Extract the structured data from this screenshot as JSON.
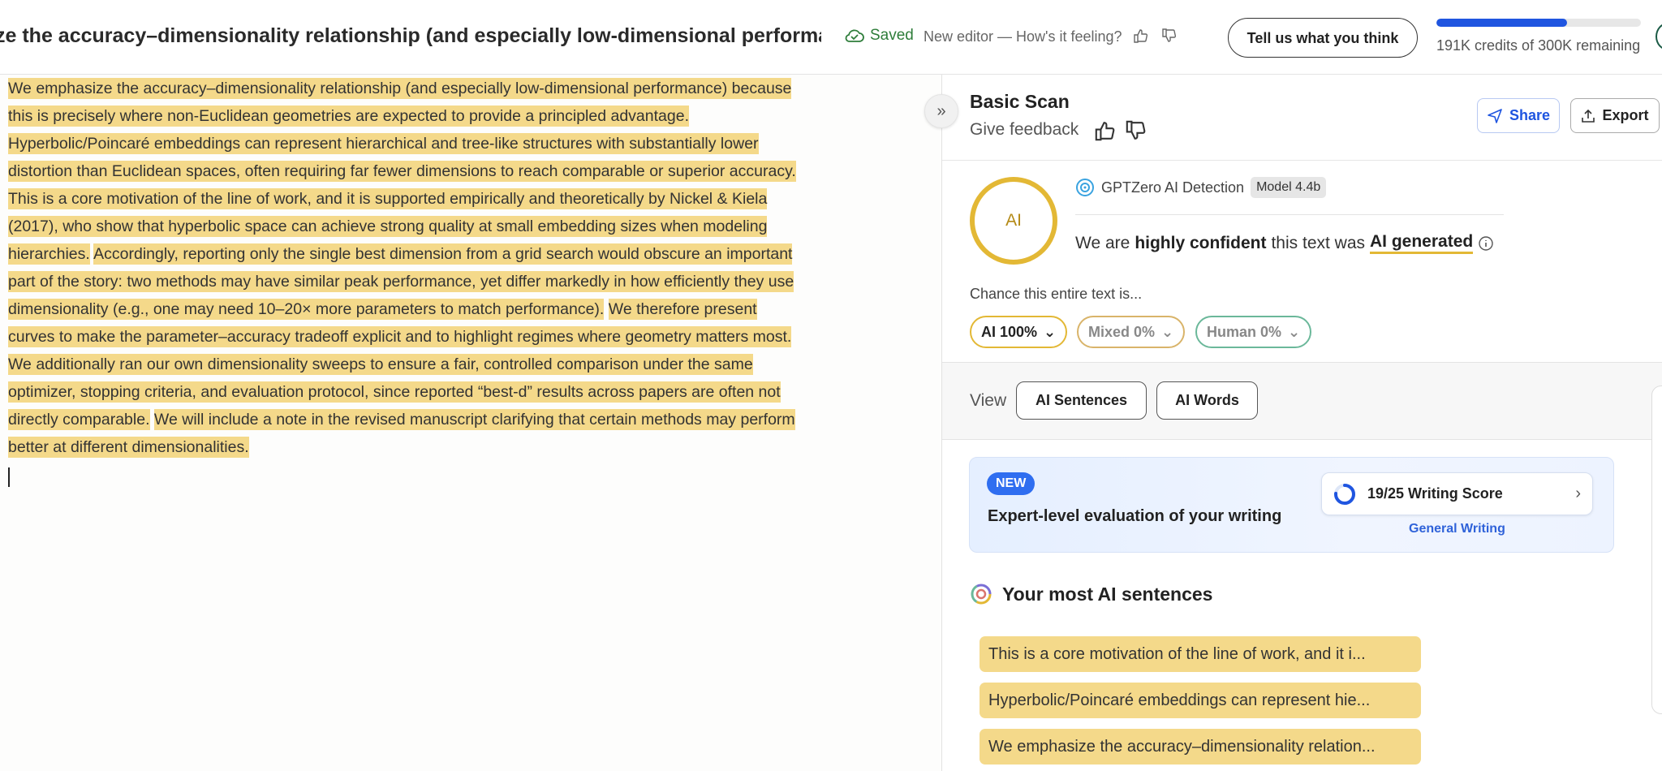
{
  "header": {
    "doc_title": "ze the accuracy–dimensionality relationship (and especially low-dimensional performance) b",
    "saved_label": "Saved",
    "editor_message": "New editor — How's it feeling?",
    "feedback_button": "Tell us what you think",
    "credits_text": "191K credits of 300K remaining",
    "credits_fraction": 0.638
  },
  "editor": {
    "paragraphs": [
      [
        "We emphasize the accuracy–dimensionality relationship (and especially low-dimensional performance) because this is precisely where non-Euclidean geometries are expected to provide a principled advantage.",
        "Hyperbolic/Poincaré embeddings can represent hierarchical and tree-like structures with substantially lower distortion than Euclidean spaces, often requiring far fewer dimensions to reach comparable or superior accuracy.",
        "This is a core motivation of the line of work, and it is supported empirically and theoretically by Nickel & Kiela (2017), who show that hyperbolic space can achieve strong quality at small embedding sizes when modeling hierarchies.",
        "Accordingly, reporting only the single best dimension from a grid search would obscure an important part of the story: two methods may have similar peak performance, yet differ markedly in how efficiently they use dimensionality (e.g., one may need 10–20× more parameters to match performance).",
        "We therefore present curves to make the parameter–accuracy tradeoff explicit and to highlight regimes where geometry matters most."
      ],
      [
        "We additionally ran our own dimensionality sweeps to ensure a fair, controlled comparison under the same optimizer, stopping criteria, and evaluation protocol, since reported “best-d” results across papers are often not directly comparable.",
        "We will include a note in the revised manuscript clarifying that certain methods may perform better at different dimensionalities."
      ]
    ]
  },
  "panel": {
    "title": "Basic Scan",
    "give_feedback": "Give feedback",
    "share_label": "Share",
    "export_label": "Export",
    "ai_badge": "AI",
    "detector_name": "GPTZero AI Detection",
    "model_tag": "Model 4.4b",
    "verdict_pre": "We are",
    "verdict_strong": "highly confident",
    "verdict_mid": "this text was",
    "verdict_ai": "AI generated",
    "chance_label": "Chance this entire text is...",
    "pills": {
      "ai": "AI 100%",
      "mixed": "Mixed 0%",
      "human": "Human 0%"
    },
    "view_label": "View",
    "view_buttons": {
      "sentences": "AI Sentences",
      "words": "AI Words"
    },
    "promo": {
      "badge": "NEW",
      "title": "Expert-level evaluation of your writing",
      "score": "19/25 Writing Score",
      "score_fraction": 0.76,
      "sub": "General Writing"
    },
    "most_ai_title": "Your most AI sentences",
    "top_sentences": [
      "This is a core motivation of the line of work, and it i...",
      "Hyperbolic/Poincaré embeddings can represent hie...",
      "We emphasize the accuracy–dimensionality relation..."
    ]
  },
  "colors": {
    "highlight": "#f4d98a",
    "accent_blue": "#1f55e0",
    "ai_yellow": "#e3b835",
    "human_green": "#6bb89a"
  },
  "icons": [
    "cloud-check-icon",
    "thumbs-up-icon",
    "thumbs-down-icon",
    "double-chevron-right-icon",
    "share-arrow-icon",
    "export-icon",
    "gptzero-logo-icon",
    "info-icon",
    "chevron-down-icon",
    "chevron-right-icon",
    "spinner-score-icon",
    "multicolor-ring-icon"
  ]
}
